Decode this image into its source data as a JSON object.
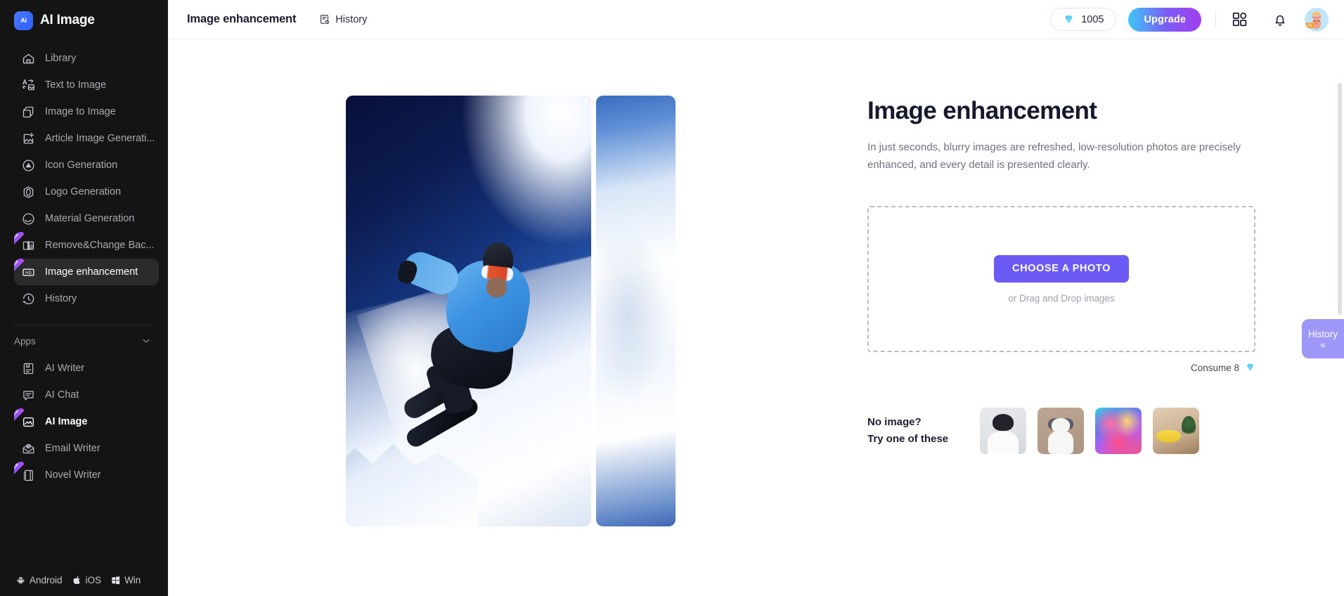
{
  "brand": {
    "name": "AI Image",
    "logo_text": "Ai"
  },
  "sidebar": {
    "items": [
      {
        "label": "Library",
        "icon": "home-icon",
        "badge": null,
        "active": false
      },
      {
        "label": "Text to Image",
        "icon": "text-to-image-icon",
        "badge": null,
        "active": false
      },
      {
        "label": "Image to Image",
        "icon": "image-to-image-icon",
        "badge": null,
        "active": false
      },
      {
        "label": "Article Image Generati...",
        "icon": "article-image-icon",
        "badge": null,
        "active": false
      },
      {
        "label": "Icon Generation",
        "icon": "icon-generation-icon",
        "badge": null,
        "active": false
      },
      {
        "label": "Logo Generation",
        "icon": "logo-generation-icon",
        "badge": null,
        "active": false
      },
      {
        "label": "Material Generation",
        "icon": "material-generation-icon",
        "badge": null,
        "active": false
      },
      {
        "label": "Remove&Change Bac...",
        "icon": "remove-background-icon",
        "badge": "new",
        "active": false
      },
      {
        "label": "Image enhancement",
        "icon": "hd-icon",
        "badge": "new",
        "active": true
      },
      {
        "label": "History",
        "icon": "clock-icon",
        "badge": null,
        "active": false
      }
    ],
    "apps_section": {
      "title": "Apps",
      "collapse_icon": "chevron-down-icon"
    },
    "apps": [
      {
        "label": "AI Writer",
        "icon": "book-icon",
        "badge": null,
        "active": false
      },
      {
        "label": "AI Chat",
        "icon": "chat-icon",
        "badge": null,
        "active": false
      },
      {
        "label": "AI Image",
        "icon": "picture-icon",
        "badge": "new",
        "active": true
      },
      {
        "label": "Email Writer",
        "icon": "envelope-icon",
        "badge": null,
        "active": false
      },
      {
        "label": "Novel Writer",
        "icon": "notebook-icon",
        "badge": "new",
        "active": false
      }
    ],
    "platforms": [
      {
        "label": "Android",
        "icon": "android-icon"
      },
      {
        "label": "iOS",
        "icon": "apple-icon"
      },
      {
        "label": "Win",
        "icon": "windows-icon"
      }
    ]
  },
  "topbar": {
    "page_title": "Image enhancement",
    "history_label": "History",
    "history_icon": "history-file-icon",
    "credits": {
      "value": "1005",
      "icon": "gem-icon"
    },
    "upgrade_label": "Upgrade",
    "apps_grid_icon": "apps-grid-icon",
    "notification_icon": "bell-icon",
    "avatar": "user-avatar"
  },
  "hero": {
    "title": "Image enhancement",
    "description": "In just seconds, blurry images are refreshed, low-resolution photos are precisely enhanced, and every detail is presented clearly."
  },
  "dropzone": {
    "button_label": "CHOOSE A PHOTO",
    "hint": "or Drag and Drop images",
    "consume_label": "Consume 8",
    "consume_icon": "gem-icon"
  },
  "samples": {
    "label_line1": "No image?",
    "label_line2": "Try one of these",
    "thumbnails": [
      {
        "name": "sample-portrait"
      },
      {
        "name": "sample-cat"
      },
      {
        "name": "sample-artwork"
      },
      {
        "name": "sample-bananas"
      }
    ]
  },
  "preview": {
    "name": "snowboarder-before-after-comparison",
    "left_panel": "enhanced-snowboarder-photo",
    "right_panel": "original-blurred-crop"
  },
  "history_tab": {
    "label": "History",
    "collapse_icon": "double-chevron-left"
  },
  "colors": {
    "sidebar_bg": "#141414",
    "accent_purple": "#6c5af5",
    "history_tab_bg": "#9d97f7",
    "upgrade_gradient_start": "#3fc8f5",
    "upgrade_gradient_end": "#a33ff0",
    "title_color": "#171a2e",
    "muted_text": "#6e7280"
  }
}
